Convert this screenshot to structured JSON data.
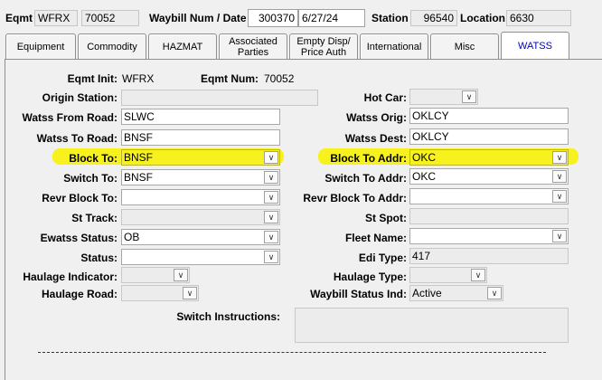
{
  "header": {
    "eqmt_label": "Eqmt",
    "eqmt_init": "WFRX",
    "eqmt_num": "70052",
    "waybill_label": "Waybill Num / Date",
    "waybill_num": "300370",
    "waybill_date": "6/27/24",
    "station_label": "Station",
    "station_value": "96540",
    "location_label": "Location",
    "location_value": "6630"
  },
  "tabs": [
    {
      "label": "Equipment"
    },
    {
      "label": "Commodity"
    },
    {
      "label": "HAZMAT"
    },
    {
      "label": "Associated Parties"
    },
    {
      "label": "Empty Disp/ Price Auth"
    },
    {
      "label": "International"
    },
    {
      "label": "Misc"
    },
    {
      "label": "WATSS"
    }
  ],
  "active_tab": "WATSS",
  "info": {
    "eqmt_init_label": "Eqmt Init:",
    "eqmt_init_value": "WFRX",
    "eqmt_num_label": "Eqmt Num:",
    "eqmt_num_value": "70052"
  },
  "left": {
    "origin_station": {
      "label": "Origin Station:",
      "value": ""
    },
    "watss_from_road": {
      "label": "Watss From Road:",
      "value": "SLWC"
    },
    "watss_to_road": {
      "label": "Watss To Road:",
      "value": "BNSF"
    },
    "block_to": {
      "label": "Block To:",
      "value": "BNSF"
    },
    "switch_to": {
      "label": "Switch To:",
      "value": "BNSF"
    },
    "revr_block_to": {
      "label": "Revr Block To:",
      "value": ""
    },
    "st_track": {
      "label": "St Track:",
      "value": ""
    },
    "ewatss_status": {
      "label": "Ewatss Status:",
      "value": "OB"
    },
    "status": {
      "label": "Status:",
      "value": ""
    },
    "haulage_indicator": {
      "label": "Haulage Indicator:",
      "value": ""
    },
    "haulage_road": {
      "label": "Haulage Road:",
      "value": ""
    }
  },
  "right": {
    "hot_car": {
      "label": "Hot Car:",
      "value": ""
    },
    "watss_orig": {
      "label": "Watss Orig:",
      "value": "OKLCY"
    },
    "watss_dest": {
      "label": "Watss Dest:",
      "value": "OKLCY"
    },
    "block_to_addr": {
      "label": "Block To Addr:",
      "value": "OKC"
    },
    "switch_to_addr": {
      "label": "Switch To Addr:",
      "value": "OKC"
    },
    "revr_block_to_addr": {
      "label": "Revr Block To Addr:",
      "value": ""
    },
    "st_spot": {
      "label": "St Spot:",
      "value": ""
    },
    "fleet_name": {
      "label": "Fleet Name:",
      "value": ""
    },
    "edi_type": {
      "label": "Edi Type:",
      "value": "417"
    },
    "haulage_type": {
      "label": "Haulage Type:",
      "value": ""
    },
    "waybill_status_ind": {
      "label": "Waybill Status Ind:",
      "value": "Active"
    }
  },
  "switch_instructions": {
    "label": "Switch Instructions:",
    "value": ""
  },
  "highlight_color": "#f7f21e",
  "active_tab_color": "#0000cc"
}
